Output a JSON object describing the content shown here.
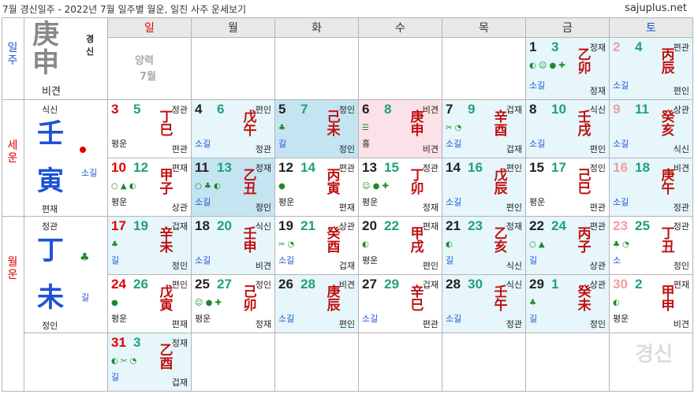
{
  "header": {
    "title": "7월 경신일주 - 2022년 7월 일주별 월운, 일진 사주 운세보기",
    "site": "sajuplus.net"
  },
  "weekdays": [
    "일",
    "월",
    "화",
    "수",
    "목",
    "금",
    "토"
  ],
  "side": {
    "ilju_label": "일주",
    "ilju_top": "庚",
    "ilju_bot": "申",
    "ilju_name": "경신",
    "ilju_sub": "비견",
    "seun_label": "세운",
    "seun_top_note": "식신",
    "seun_top": "壬",
    "seun_bot": "寅",
    "seun_bot_note": "편재",
    "seun_side": "소길",
    "wolun_label": "월운",
    "wolun_top_note": "정관",
    "wolun_top": "丁",
    "wolun_bot": "未",
    "wolun_bot_note": "정인",
    "wolun_side": "길",
    "yanglyeok": "양력",
    "month": "7월"
  },
  "watermark": "경신",
  "days": [
    {
      "d": "1",
      "l": "3",
      "top": "정재",
      "h1": "乙",
      "h2": "卯",
      "bot": "정재",
      "fort": "소길",
      "icons": "◐ ☺ ● ✚"
    },
    {
      "d": "2",
      "l": "4",
      "top": "편관",
      "h1": "丙",
      "h2": "辰",
      "bot": "편인",
      "fort": "소길",
      "icons": ""
    },
    {
      "d": "3",
      "l": "5",
      "top": "정관",
      "h1": "丁",
      "h2": "巳",
      "bot": "편관",
      "fort": "평운",
      "icons": ""
    },
    {
      "d": "4",
      "l": "6",
      "top": "편인",
      "h1": "戊",
      "h2": "午",
      "bot": "정관",
      "fort": "소길",
      "icons": ""
    },
    {
      "d": "5",
      "l": "7",
      "top": "정인",
      "h1": "己",
      "h2": "未",
      "bot": "정인",
      "fort": "길",
      "icons": "♣"
    },
    {
      "d": "6",
      "l": "8",
      "top": "비견",
      "h1": "庚",
      "h2": "申",
      "bot": "비견",
      "fort": "흉",
      "icons": "☰"
    },
    {
      "d": "7",
      "l": "9",
      "top": "겁재",
      "h1": "辛",
      "h2": "酉",
      "bot": "겁재",
      "fort": "소길",
      "icons": "✂ ◔"
    },
    {
      "d": "8",
      "l": "10",
      "top": "식신",
      "h1": "壬",
      "h2": "戌",
      "bot": "편인",
      "fort": "소길",
      "icons": ""
    },
    {
      "d": "9",
      "l": "11",
      "top": "상관",
      "h1": "癸",
      "h2": "亥",
      "bot": "식신",
      "fort": "소길",
      "icons": ""
    },
    {
      "d": "10",
      "l": "12",
      "top": "편재",
      "h1": "甲",
      "h2": "子",
      "bot": "상관",
      "fort": "평운",
      "icons": "○ ▲ ◐"
    },
    {
      "d": "11",
      "l": "13",
      "top": "정재",
      "h1": "乙",
      "h2": "丑",
      "bot": "정인",
      "fort": "소길",
      "icons": "○ ♣ ◐"
    },
    {
      "d": "12",
      "l": "14",
      "top": "편관",
      "h1": "丙",
      "h2": "寅",
      "bot": "편재",
      "fort": "평운",
      "icons": "●"
    },
    {
      "d": "13",
      "l": "15",
      "top": "정관",
      "h1": "丁",
      "h2": "卯",
      "bot": "정재",
      "fort": "평운",
      "icons": "☺ ● ✚"
    },
    {
      "d": "14",
      "l": "16",
      "top": "편인",
      "h1": "戊",
      "h2": "辰",
      "bot": "편인",
      "fort": "소길",
      "icons": ""
    },
    {
      "d": "15",
      "l": "17",
      "top": "정인",
      "h1": "己",
      "h2": "巳",
      "bot": "편관",
      "fort": "평운",
      "icons": ""
    },
    {
      "d": "16",
      "l": "18",
      "top": "비견",
      "h1": "庚",
      "h2": "午",
      "bot": "정관",
      "fort": "소길",
      "icons": ""
    },
    {
      "d": "17",
      "l": "19",
      "top": "겁재",
      "h1": "辛",
      "h2": "未",
      "bot": "정인",
      "fort": "길",
      "icons": "♣"
    },
    {
      "d": "18",
      "l": "20",
      "top": "식신",
      "h1": "壬",
      "h2": "申",
      "bot": "비견",
      "fort": "소길",
      "icons": ""
    },
    {
      "d": "19",
      "l": "21",
      "top": "상관",
      "h1": "癸",
      "h2": "酉",
      "bot": "겁재",
      "fort": "소길",
      "icons": "✂ ◔"
    },
    {
      "d": "20",
      "l": "22",
      "top": "편재",
      "h1": "甲",
      "h2": "戌",
      "bot": "편인",
      "fort": "평운",
      "icons": "◐"
    },
    {
      "d": "21",
      "l": "23",
      "top": "정재",
      "h1": "乙",
      "h2": "亥",
      "bot": "식신",
      "fort": "길",
      "icons": "◐"
    },
    {
      "d": "22",
      "l": "24",
      "top": "편관",
      "h1": "丙",
      "h2": "子",
      "bot": "상관",
      "fort": "길",
      "icons": "○ ▲"
    },
    {
      "d": "23",
      "l": "25",
      "top": "정관",
      "h1": "丁",
      "h2": "丑",
      "bot": "정인",
      "fort": "소",
      "icons": "♣ ◔"
    },
    {
      "d": "24",
      "l": "26",
      "top": "편인",
      "h1": "戊",
      "h2": "寅",
      "bot": "편재",
      "fort": "평운",
      "icons": "●"
    },
    {
      "d": "25",
      "l": "27",
      "top": "정인",
      "h1": "己",
      "h2": "卯",
      "bot": "정재",
      "fort": "평운",
      "icons": "☺ ● ✚"
    },
    {
      "d": "26",
      "l": "28",
      "top": "비견",
      "h1": "庚",
      "h2": "辰",
      "bot": "편인",
      "fort": "소길",
      "icons": ""
    },
    {
      "d": "27",
      "l": "29",
      "top": "겁재",
      "h1": "辛",
      "h2": "巳",
      "bot": "편관",
      "fort": "소길",
      "icons": ""
    },
    {
      "d": "28",
      "l": "30",
      "top": "식신",
      "h1": "壬",
      "h2": "午",
      "bot": "정관",
      "fort": "소길",
      "icons": ""
    },
    {
      "d": "29",
      "l": "1",
      "top": "상관",
      "h1": "癸",
      "h2": "未",
      "bot": "정인",
      "fort": "길",
      "icons": "♣"
    },
    {
      "d": "30",
      "l": "2",
      "top": "편재",
      "h1": "甲",
      "h2": "申",
      "bot": "비견",
      "fort": "평운",
      "icons": "◐"
    },
    {
      "d": "31",
      "l": "3",
      "top": "정재",
      "h1": "乙",
      "h2": "酉",
      "bot": "겁재",
      "fort": "길",
      "icons": "◐ ✂ ◔"
    }
  ]
}
